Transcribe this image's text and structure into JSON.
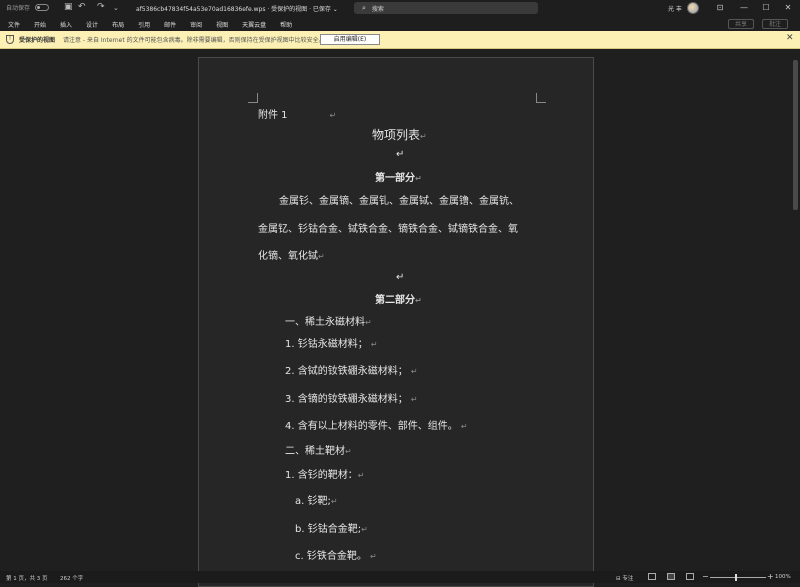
{
  "titlebar": {
    "autosave_label": "自动保存",
    "doc_title": "af5386cb47834f54a53e70ad16836efe.wps · 受保护的视图 · 已保存 ⌄",
    "search_placeholder": "搜索",
    "user_name": "光 丰"
  },
  "menu": {
    "items": [
      "文件",
      "开始",
      "插入",
      "设计",
      "布局",
      "引用",
      "邮件",
      "审阅",
      "视图",
      "天翼云盘",
      "帮助"
    ],
    "right_buttons": [
      "共享",
      "批注"
    ]
  },
  "protected_bar": {
    "title": "受保护的视图",
    "message": "请注意 - 来自 Internet 的文件可能包含病毒。除非需要编辑，否则保持在受保护视图中比较安全。",
    "enable_button": "启用编辑(E)"
  },
  "document": {
    "attachment": "附件 1",
    "title": "物项列表",
    "part1_heading": "第一部分",
    "part1_line1": "金属钐、金属镝、金属钆、金属铽、金属镥、金属钪、",
    "part1_line2": "金属钇、钐钴合金、铽铁合金、镝铁合金、铽镝铁合金、氧",
    "part1_line3": "化镝、氧化铽",
    "part2_heading": "第二部分",
    "section1": "一、稀土永磁材料",
    "item1": "1.  钐钴永磁材料；",
    "item2": "2.  含铽的钕铁硼永磁材料；",
    "item3": "3.  含镝的钕铁硼永磁材料；",
    "item4": "4.  含有以上材料的零件、部件、组件。",
    "section2": "二、稀土靶材",
    "item2_1": "1.  含钐的靶材：",
    "sub_a": "a.  钐靶;",
    "sub_b": "b.  钐钴合金靶;",
    "sub_c": "c.  钐铁合金靶。",
    "para_mark": "↵"
  },
  "status": {
    "page_info": "第 1 页，共 3 页",
    "word_count": "262 个字",
    "focus_label": "专注",
    "zoom": "100%"
  }
}
